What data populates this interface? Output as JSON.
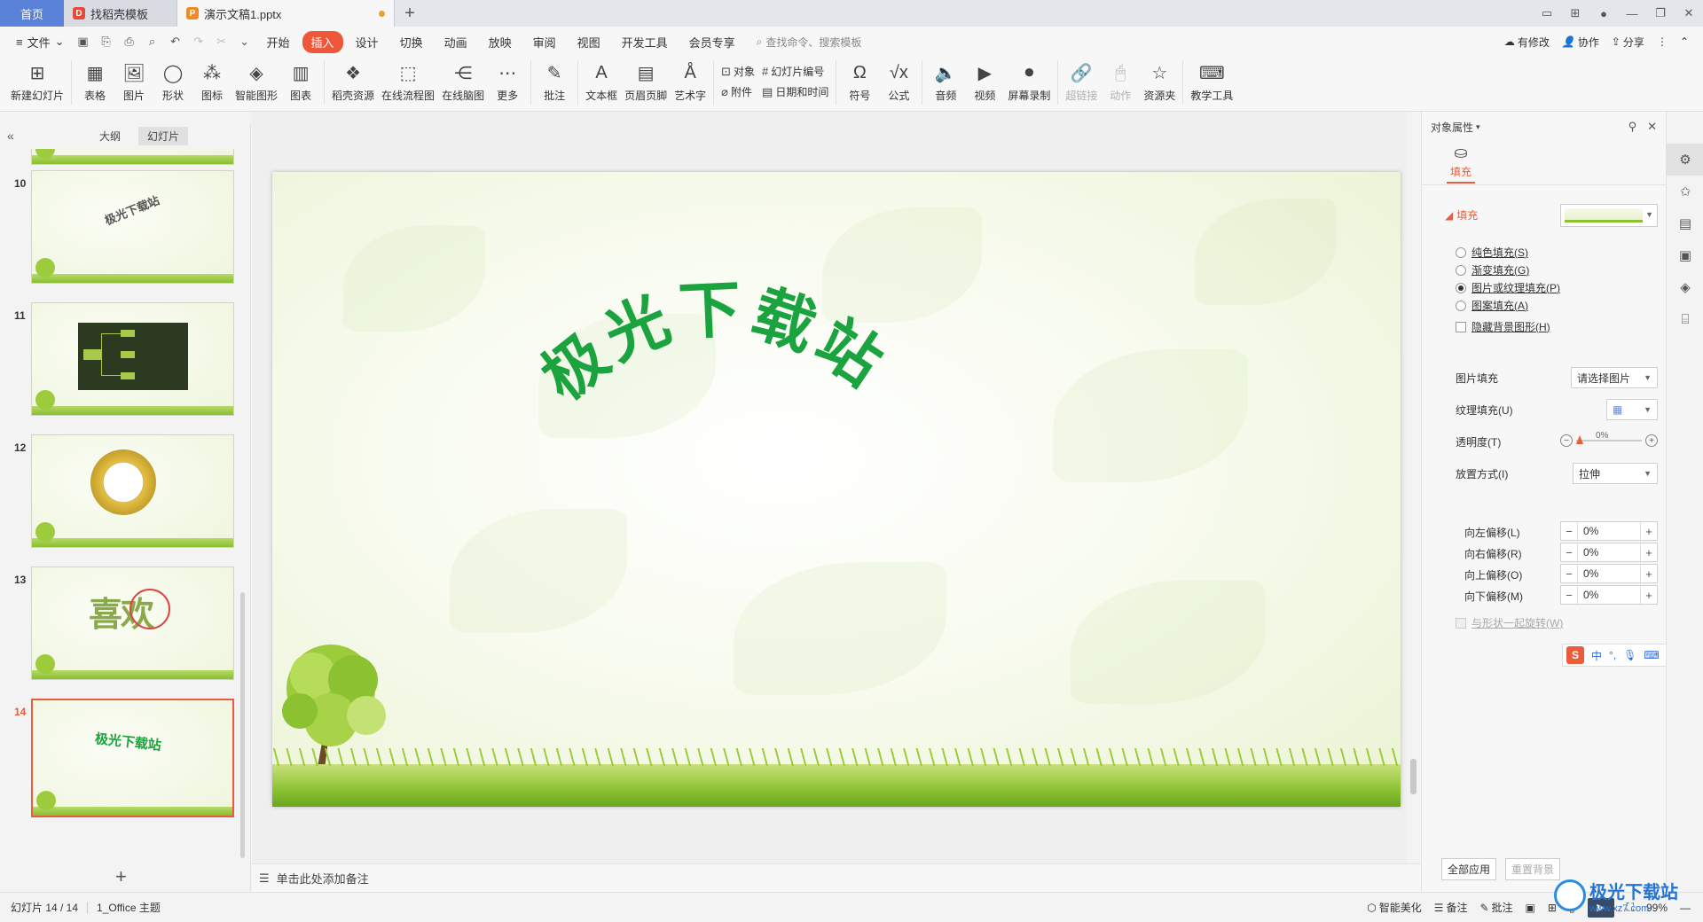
{
  "titlebar": {
    "home": "首页",
    "tabs": [
      {
        "label": "找稻壳模板",
        "logo": "D"
      },
      {
        "label": "演示文稿1.pptx",
        "logo": "P"
      }
    ]
  },
  "menubar": {
    "file": "文件",
    "tabs": [
      "开始",
      "插入",
      "设计",
      "切换",
      "动画",
      "放映",
      "审阅",
      "视图",
      "开发工具",
      "会员专享"
    ],
    "active_tab": "插入",
    "search": "查找命令、搜索模板",
    "right": [
      "有修改",
      "协作",
      "分享"
    ]
  },
  "ribbon": {
    "groups": [
      {
        "label": "新建幻灯片",
        "icon": "new-slide-icon",
        "glyph": "⊞"
      },
      {
        "label": "表格",
        "icon": "table-icon",
        "glyph": "▦"
      },
      {
        "label": "图片",
        "icon": "picture-icon",
        "glyph": "🖼"
      },
      {
        "label": "形状",
        "icon": "shape-icon",
        "glyph": "◯"
      },
      {
        "label": "图标",
        "icon": "icons-icon",
        "glyph": "⁂"
      },
      {
        "label": "智能图形",
        "icon": "smartart-icon",
        "glyph": "◈"
      },
      {
        "label": "图表",
        "icon": "chart-icon",
        "glyph": "▥"
      },
      {
        "label": "稻壳资源",
        "icon": "resource-icon",
        "glyph": "❖"
      },
      {
        "label": "在线流程图",
        "icon": "flowchart-icon",
        "glyph": "⬚"
      },
      {
        "label": "在线脑图",
        "icon": "mindmap-icon",
        "glyph": "⋲"
      },
      {
        "label": "更多",
        "icon": "more-icon",
        "glyph": "⋯"
      },
      {
        "label": "批注",
        "icon": "comment-icon",
        "glyph": "✎"
      },
      {
        "label": "文本框",
        "icon": "textbox-icon",
        "glyph": "A"
      },
      {
        "label": "页眉页脚",
        "icon": "header-footer-icon",
        "glyph": "▤"
      },
      {
        "label": "艺术字",
        "icon": "wordart-icon",
        "glyph": "Å"
      }
    ],
    "small_a": [
      "对象",
      "附件"
    ],
    "small_b": [
      "幻灯片编号",
      "日期和时间"
    ],
    "groups2": [
      {
        "label": "符号",
        "icon": "symbol-icon",
        "glyph": "Ω"
      },
      {
        "label": "公式",
        "icon": "formula-icon",
        "glyph": "√x"
      },
      {
        "label": "音频",
        "icon": "audio-icon",
        "glyph": "🔈"
      },
      {
        "label": "视频",
        "icon": "video-icon",
        "glyph": "▶"
      },
      {
        "label": "屏幕录制",
        "icon": "record-icon",
        "glyph": "⏺"
      },
      {
        "label": "超链接",
        "icon": "hyperlink-icon",
        "glyph": "🔗",
        "disabled": true
      },
      {
        "label": "动作",
        "icon": "action-icon",
        "glyph": "🖱",
        "disabled": true
      },
      {
        "label": "资源夹",
        "icon": "folder-star-icon",
        "glyph": "☆"
      },
      {
        "label": "教学工具",
        "icon": "teaching-icon",
        "glyph": "⌨"
      }
    ]
  },
  "left_panel": {
    "tabs": [
      "大纲",
      "幻灯片"
    ],
    "active_tab": "幻灯片",
    "slides": [
      {
        "num": "10",
        "text": "极光下载站"
      },
      {
        "num": "11",
        "text": ""
      },
      {
        "num": "12",
        "text": ""
      },
      {
        "num": "13",
        "text": "喜欢"
      },
      {
        "num": "14",
        "text": "极光下载站"
      }
    ]
  },
  "slide": {
    "title": "极光下载站"
  },
  "notes": {
    "placeholder": "单击此处添加备注"
  },
  "properties": {
    "header": "对象属性",
    "tab": "填充",
    "section": "填充",
    "options": [
      {
        "label": "纯色填充(",
        "key": "S",
        "type": "radio",
        "checked": false
      },
      {
        "label": "渐变填充(",
        "key": "G",
        "type": "radio",
        "checked": false
      },
      {
        "label": "图片或纹理填充(",
        "key": "P",
        "type": "radio",
        "checked": true
      },
      {
        "label": "图案填充(",
        "key": "A",
        "type": "radio",
        "checked": false
      },
      {
        "label": "隐藏背景图形(",
        "key": "H",
        "type": "check",
        "checked": false
      }
    ],
    "picture_fill_label": "图片填充",
    "picture_fill_value": "请选择图片",
    "texture_fill_label": "纹理填充(U)",
    "transparency_label": "透明度(T)",
    "transparency_value": "0%",
    "transparency": 0,
    "placement_label": "放置方式(I)",
    "placement_value": "拉伸",
    "offsets": [
      {
        "label": "向左偏移(L)",
        "value": "0%"
      },
      {
        "label": "向右偏移(R)",
        "value": "0%"
      },
      {
        "label": "向上偏移(O)",
        "value": "0%"
      },
      {
        "label": "向下偏移(M)",
        "value": "0%"
      }
    ],
    "rotate_with_shape": "与形状一起旋转(W)",
    "apply_all": "全部应用",
    "reset_bg": "重置背景"
  },
  "ime": {
    "lang": "中"
  },
  "status": {
    "slide_info": "幻灯片 14 / 14",
    "theme": "1_Office 主题",
    "beautify": "智能美化",
    "notes": "备注",
    "comments": "批注",
    "zoom": "99%"
  },
  "watermark": {
    "title": "极光下载站",
    "url": "www.xz7.com"
  },
  "colors": {
    "accent": "#e95d3c",
    "title_green": "#1aa33e",
    "home_tab": "#5a82d8"
  }
}
